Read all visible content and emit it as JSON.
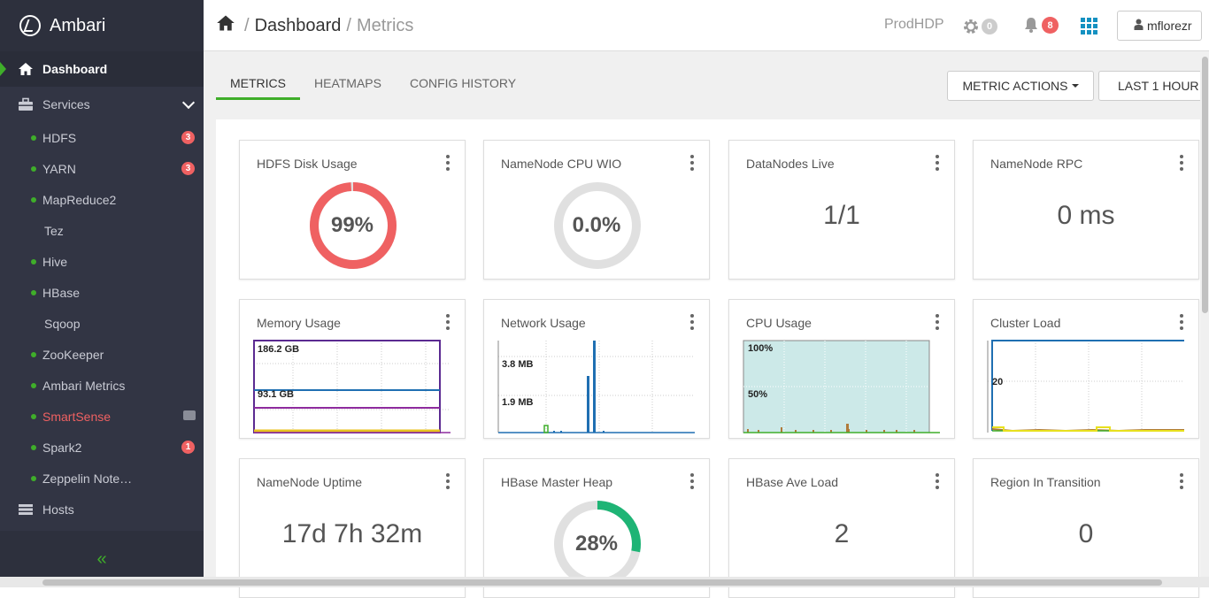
{
  "sidebar": {
    "brand": "Ambari",
    "dashboard_label": "Dashboard",
    "services_label": "Services",
    "hosts_label": "Hosts",
    "services": [
      {
        "name": "HDFS",
        "status": "green",
        "badge": "3"
      },
      {
        "name": "YARN",
        "status": "green",
        "badge": "3"
      },
      {
        "name": "MapReduce2",
        "status": "green",
        "badge": ""
      },
      {
        "name": "Tez",
        "status": "none",
        "badge": ""
      },
      {
        "name": "Hive",
        "status": "green",
        "badge": ""
      },
      {
        "name": "HBase",
        "status": "green",
        "badge": ""
      },
      {
        "name": "Sqoop",
        "status": "none",
        "badge": ""
      },
      {
        "name": "ZooKeeper",
        "status": "green",
        "badge": ""
      },
      {
        "name": "Ambari Metrics",
        "status": "green",
        "badge": ""
      },
      {
        "name": "SmartSense",
        "status": "green",
        "badge": ""
      },
      {
        "name": "Spark2",
        "status": "green",
        "badge": "1"
      },
      {
        "name": "Zeppelin Note…",
        "status": "green",
        "badge": ""
      }
    ],
    "collapse_glyph": "«"
  },
  "header": {
    "breadcrumb_root": "Dashboard",
    "breadcrumb_current": "Metrics",
    "separator": "/",
    "cluster_name": "ProdHDP",
    "ops_count": "0",
    "alerts_count": "8",
    "user": "mflorezr"
  },
  "tabs": [
    {
      "label": "METRICS",
      "active": true
    },
    {
      "label": "HEATMAPS",
      "active": false
    },
    {
      "label": "CONFIG HISTORY",
      "active": false
    }
  ],
  "buttons": {
    "metric_actions": "METRIC ACTIONS",
    "time_range": "LAST 1 HOUR"
  },
  "widgets": {
    "hdfs_disk": {
      "title": "HDFS Disk Usage",
      "value": "99%",
      "fraction": 0.99
    },
    "nn_cpu": {
      "title": "NameNode CPU WIO",
      "value": "0.0%",
      "fraction": 0.0
    },
    "datanodes": {
      "title": "DataNodes Live",
      "value": "1/1"
    },
    "nn_rpc": {
      "title": "NameNode RPC",
      "value": "0 ms"
    },
    "memory": {
      "title": "Memory Usage",
      "label_top": "186.2 GB",
      "label_mid": "93.1 GB"
    },
    "network": {
      "title": "Network Usage",
      "label_top": "3.8 MB",
      "label_mid": "1.9 MB"
    },
    "cpu": {
      "title": "CPU Usage",
      "label_top": "100%",
      "label_mid": "50%"
    },
    "cluster_load": {
      "title": "Cluster Load",
      "label_mid": "20"
    },
    "nn_uptime": {
      "title": "NameNode Uptime",
      "value": "17d 7h 32m"
    },
    "hbase_heap": {
      "title": "HBase Master Heap",
      "value": "28%",
      "fraction": 0.28
    },
    "hbase_load": {
      "title": "HBase Ave Load",
      "value": "2"
    },
    "region_transition": {
      "title": "Region In Transition",
      "value": "0"
    }
  },
  "colors": {
    "sidebar_bg": "#323544",
    "accent_green": "#3fae2a",
    "alert_red": "#ef6162",
    "link_blue": "#1491c1"
  }
}
